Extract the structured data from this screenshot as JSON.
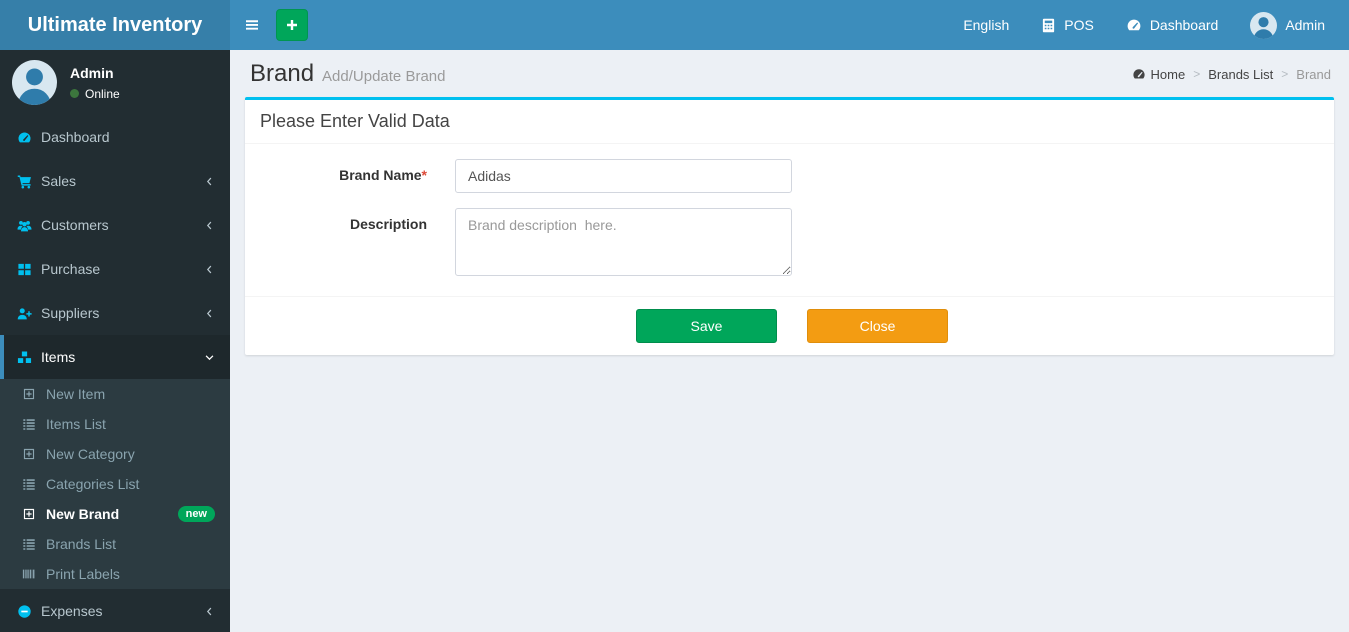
{
  "app": {
    "title": "Ultimate Inventory"
  },
  "navbar": {
    "language_label": "English",
    "pos_label": "POS",
    "dashboard_label": "Dashboard",
    "user_label": "Admin"
  },
  "sidebar": {
    "user": {
      "name": "Admin",
      "status": "Online"
    },
    "menu": [
      {
        "label": "Dashboard"
      },
      {
        "label": "Sales"
      },
      {
        "label": "Customers"
      },
      {
        "label": "Purchase"
      },
      {
        "label": "Suppliers"
      },
      {
        "label": "Items",
        "children": [
          {
            "label": "New Item"
          },
          {
            "label": "Items List"
          },
          {
            "label": "New Category"
          },
          {
            "label": "Categories List"
          },
          {
            "label": "New Brand",
            "badge": "new"
          },
          {
            "label": "Brands List"
          },
          {
            "label": "Print Labels"
          }
        ]
      },
      {
        "label": "Expenses"
      }
    ]
  },
  "page": {
    "title": "Brand",
    "subtitle": "Add/Update Brand",
    "breadcrumb": [
      "Home",
      "Brands List",
      "Brand"
    ],
    "breadcrumb_separator": ">"
  },
  "form": {
    "panel_title": "Please Enter Valid Data",
    "brand_name": {
      "label": "Brand Name",
      "required_mark": "*",
      "value": "Adidas"
    },
    "description": {
      "label": "Description",
      "placeholder": "Brand description  here."
    },
    "save_label": "Save",
    "close_label": "Close"
  },
  "colors": {
    "navbar_bg": "#3c8dbc",
    "logo_bg": "#367fa9",
    "sidebar_bg": "#222d32",
    "submenu_bg": "#2c3b41",
    "panel_accent": "#00c0ef",
    "sidebar_icon_accent": "#00c0ef",
    "save_green": "#00a65a",
    "close_orange": "#f39c12",
    "online_green": "#3c763d",
    "required_red": "#dd4b39"
  }
}
